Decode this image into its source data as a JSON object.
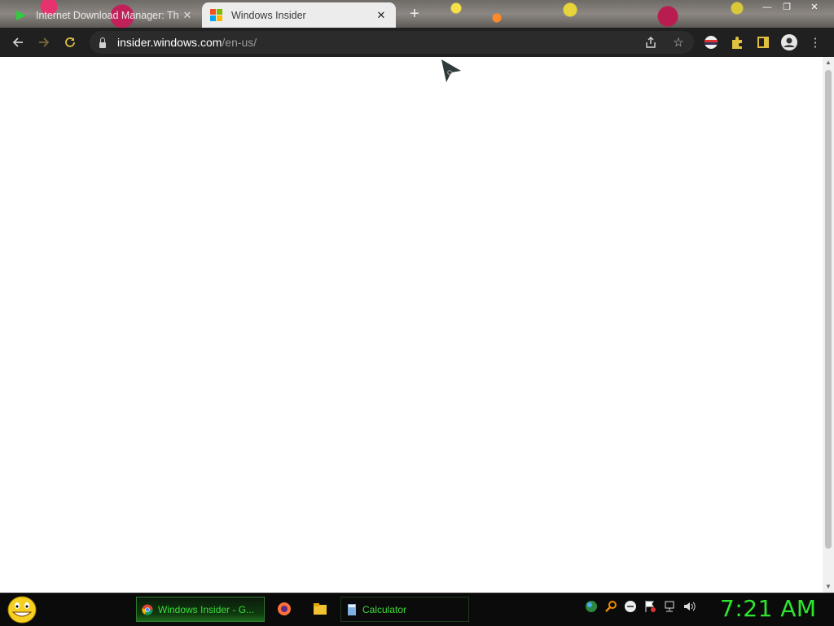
{
  "browser": {
    "tabs": [
      {
        "title": "Internet Download Manager: Th",
        "active": false
      },
      {
        "title": "Windows Insider",
        "active": true
      }
    ],
    "address": {
      "domain": "insider.windows.com",
      "path": "/en-us/"
    }
  },
  "taskbar": {
    "items": [
      {
        "label": "Windows Insider - G...",
        "active": true
      },
      {
        "label": "Calculator",
        "active": false
      }
    ],
    "clock": "7:21 AM"
  },
  "colors": {
    "clock": "#2ee62e",
    "taskbar_text": "#3ddc3d",
    "toolbar_bg": "#202020"
  }
}
